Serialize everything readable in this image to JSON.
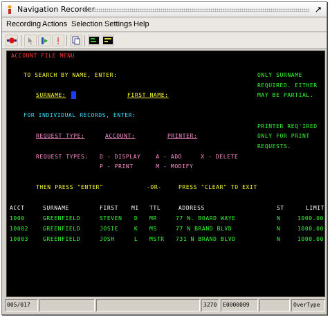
{
  "window": {
    "title": "Navigation Recorder"
  },
  "menu": [
    "Recording",
    "Actions",
    "Selection",
    "Settings",
    "Help"
  ],
  "toolbar": {
    "buttons": [
      "record-icon",
      "pointer-icon",
      "step-icon",
      "pause-icon",
      "copy-icon",
      "terminal-icon",
      "terminal-alt-icon"
    ]
  },
  "terminal": {
    "header": "ACCOUNT FILE MENU",
    "search_prompt": "TO SEARCH BY NAME, ENTER:",
    "surname_label": "SURNAME:",
    "first_name_label": "FIRST NAME:",
    "side_note_1": [
      "ONLY SURNAME",
      "REQUIRED. EITHER",
      "MAY BE PARTIAL."
    ],
    "individual_prompt": "FOR INDIVIDUAL RECORDS, ENTER:",
    "request_type_label": "REQUEST TYPE:",
    "account_label": "ACCOUNT:",
    "printer_label": "PRINTER:",
    "side_note_2": [
      "PRINTER REQ'IRED",
      "ONLY FOR PRINT",
      "REQUESTS."
    ],
    "request_types_label": "REQUEST TYPES:",
    "request_types_row1": "D - DISPLAY    A - ADD     X - DELETE",
    "request_types_row2": "P - PRINT      M - MODIFY",
    "enter_instruction": "THEN PRESS \"ENTER\"",
    "or_label": "-OR-",
    "clear_instruction": "PRESS \"CLEAR\" TO EXIT",
    "columns": [
      "ACCT",
      "SURNAME",
      "FIRST",
      "MI",
      "TTL",
      "ADDRESS",
      "ST",
      "LIMIT"
    ],
    "rows": [
      {
        "acct": "1000",
        "surname": "GREENFIELD",
        "first": "STEVEN",
        "mi": "D",
        "ttl": "MR",
        "address": "77 N. BOARD WAYE",
        "st": "N",
        "limit": "1000.00"
      },
      {
        "acct": "10002",
        "surname": "GREENFIELD",
        "first": "JOSIE",
        "mi": "K",
        "ttl": "MS",
        "address": "77 N BRAND BLVD",
        "st": "N",
        "limit": "1000.00"
      },
      {
        "acct": "10003",
        "surname": "GREENFIELD",
        "first": "JOSH",
        "mi": "L",
        "ttl": "MSTR",
        "address": "731 N BRAND BLVD",
        "st": "N",
        "limit": "1000.00"
      }
    ]
  },
  "status": {
    "position": "005/017",
    "model": "3270",
    "terminal_id": "E0000009",
    "mode": "OverType"
  }
}
